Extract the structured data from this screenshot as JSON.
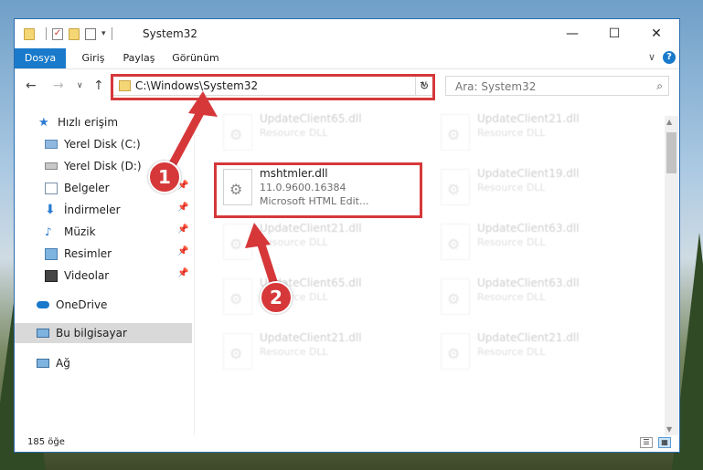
{
  "window": {
    "title": "System32",
    "controls": {
      "minimize": "—",
      "maximize": "☐",
      "close": "✕"
    }
  },
  "ribbon": {
    "tabs": [
      "Dosya",
      "Giriş",
      "Paylaş",
      "Görünüm"
    ],
    "help": "?",
    "expand": "∨"
  },
  "address": {
    "path": "C:\\Windows\\System32",
    "search_placeholder": "Ara: System32"
  },
  "nav": {
    "quick_access": "Hızlı erişim",
    "items": [
      "Yerel Disk (C:)",
      "Yerel Disk (D:)",
      "Belgeler",
      "İndirmeler",
      "Müzik",
      "Resimler",
      "Videolar"
    ],
    "onedrive": "OneDrive",
    "this_pc": "Bu bilgisayar",
    "network": "Ağ"
  },
  "files": {
    "highlight": {
      "name": "mshtmler.dll",
      "version": "11.0.9600.16384",
      "description": "Microsoft HTML Edit..."
    },
    "faded_left": [
      {
        "name": "UpdateClient65.dll",
        "type": "Resource DLL"
      },
      {
        "name": "UpdateClient21.dll",
        "type": "Resource DLL"
      },
      {
        "name": "UpdateClient65.dll",
        "type": "Resource DLL"
      },
      {
        "name": "UpdateClient21.dll",
        "type": "Resource DLL"
      }
    ],
    "faded_right": [
      {
        "name": "UpdateClient21.dll",
        "type": "Resource DLL"
      },
      {
        "name": "UpdateClient19.dll",
        "type": "Resource DLL"
      },
      {
        "name": "UpdateClient63.dll",
        "type": "Resource DLL"
      },
      {
        "name": "UpdateClient63.dll",
        "type": "Resource DLL"
      },
      {
        "name": "UpdateClient21.dll",
        "type": "Resource DLL"
      }
    ]
  },
  "status": {
    "count": "185 öğe"
  },
  "callouts": {
    "one": "1",
    "two": "2"
  },
  "colors": {
    "accent": "#1979ca",
    "annotation_red": "#d6383a"
  }
}
